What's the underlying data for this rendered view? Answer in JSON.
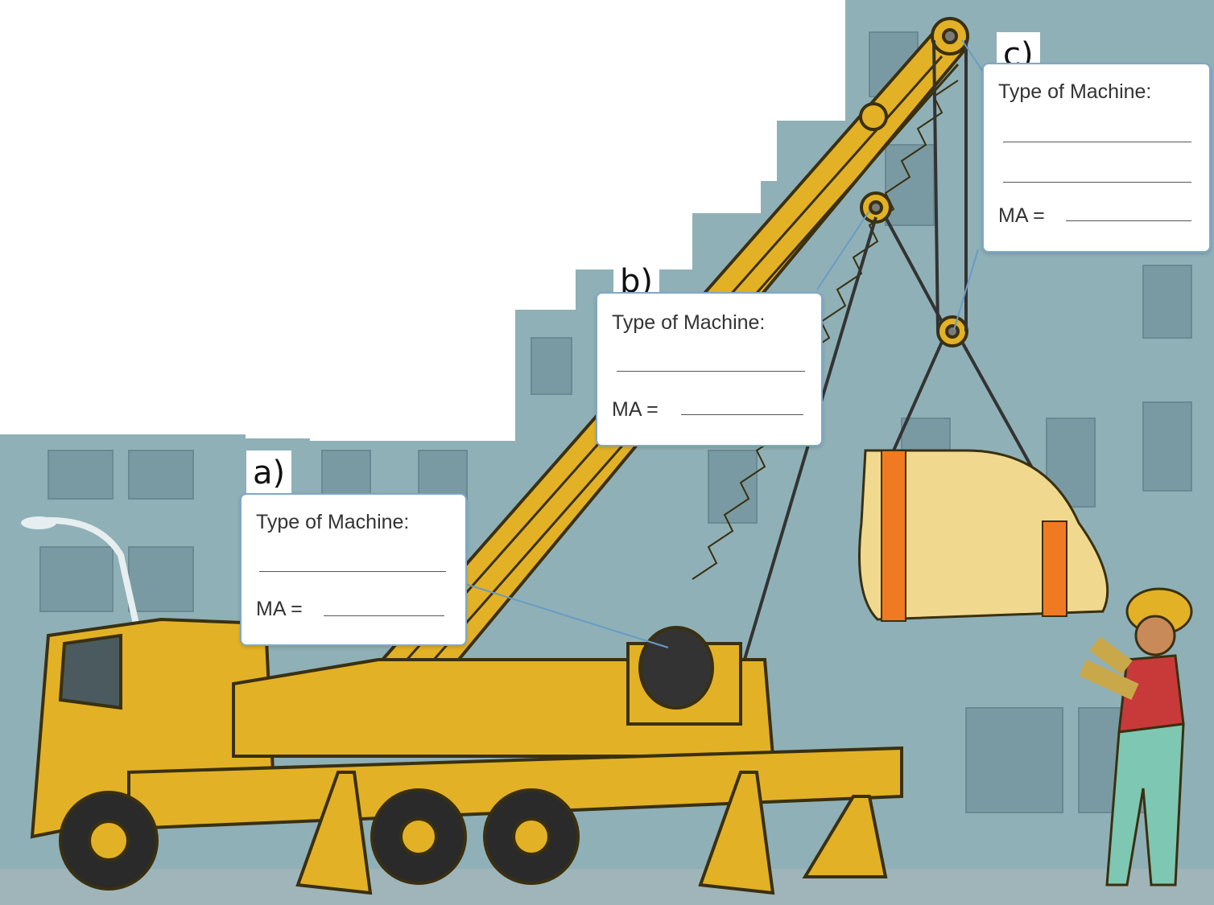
{
  "labels": [
    {
      "letter": "a)",
      "type_label": "Type of Machine:",
      "ma_label": "MA ="
    },
    {
      "letter": "b)",
      "type_label": "Type of Machine:",
      "ma_label": "MA ="
    },
    {
      "letter": "c)",
      "type_label": "Type of Machine:",
      "ma_label": "MA ="
    }
  ],
  "colors": {
    "truck_yellow": "#e3b125",
    "building": "#8fb0b7",
    "sling": "#f07a22",
    "load": "#f0d98f",
    "label_border": "#7fa8c9"
  }
}
